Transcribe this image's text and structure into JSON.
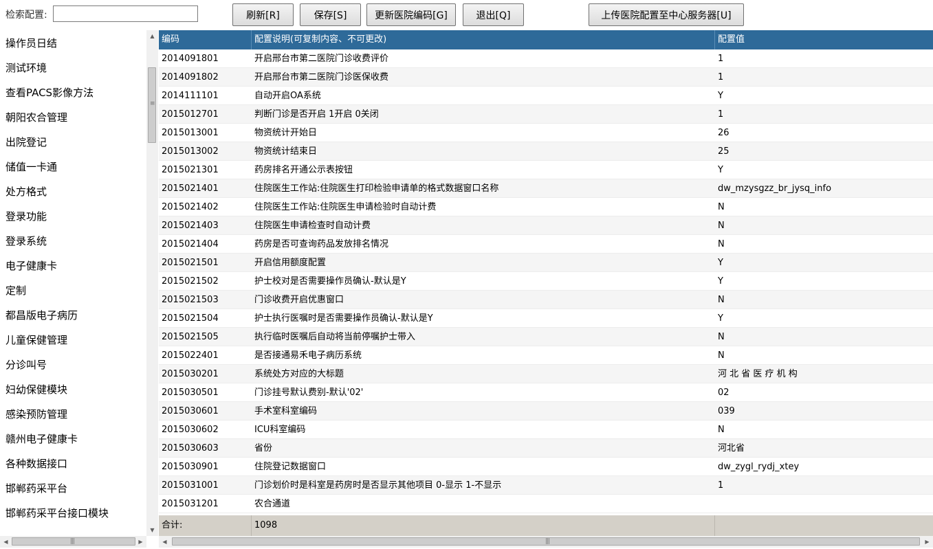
{
  "toolbar": {
    "search_label": "检索配置:",
    "search_value": "",
    "buttons": {
      "refresh": "刷新[R]",
      "save": "保存[S]",
      "update_code": "更新医院编码[G]",
      "exit": "退出[Q]",
      "upload": "上传医院配置至中心服务器[U]"
    }
  },
  "categories": [
    "操作员日结",
    "测试环境",
    "查看PACS影像方法",
    "朝阳农合管理",
    "出院登记",
    "储值一卡通",
    "处方格式",
    "登录功能",
    "登录系统",
    "电子健康卡",
    "定制",
    "都昌版电子病历",
    "儿童保健管理",
    "分诊叫号",
    "妇幼保健模块",
    "感染预防管理",
    "赣州电子健康卡",
    "各种数据接口",
    "邯郸药采平台",
    "邯郸药采平台接口模块"
  ],
  "grid": {
    "columns": [
      "编码",
      "配置说明(可复制内容、不可更改)",
      "配置值"
    ],
    "rows": [
      [
        "2014091801",
        "开启邢台市第二医院门诊收费评价",
        "1"
      ],
      [
        "2014091802",
        "开启邢台市第二医院门诊医保收费",
        "1"
      ],
      [
        "2014111101",
        "自动开启OA系统",
        "Y"
      ],
      [
        "2015012701",
        "判断门诊是否开启 1开启 0关闭",
        "1"
      ],
      [
        "2015013001",
        "物资统计开始日",
        "26"
      ],
      [
        "2015013002",
        "物资统计结束日",
        "25"
      ],
      [
        "2015021301",
        "药房排名开通公示表按钮",
        "Y"
      ],
      [
        "2015021401",
        "住院医生工作站:住院医生打印检验申请单的格式数据窗口名称",
        "dw_mzysgzz_br_jysq_info"
      ],
      [
        "2015021402",
        "住院医生工作站:住院医生申请检验时自动计费",
        "N"
      ],
      [
        "2015021403",
        "住院医生申请检查时自动计费",
        "N"
      ],
      [
        "2015021404",
        "药房是否可查询药品发放排名情况",
        "N"
      ],
      [
        "2015021501",
        "开启信用额度配置",
        "Y"
      ],
      [
        "2015021502",
        "护士校对是否需要操作员确认-默认是Y",
        "Y"
      ],
      [
        "2015021503",
        "门诊收费开启优惠窗口",
        "N"
      ],
      [
        "2015021504",
        "护士执行医嘱时是否需要操作员确认-默认是Y",
        "Y"
      ],
      [
        "2015021505",
        "执行临时医嘱后自动将当前停嘱护士带入",
        "N"
      ],
      [
        "2015022401",
        "是否接通易禾电子病历系统",
        "N"
      ],
      [
        "2015030201",
        "系统处方对应的大标题",
        "河 北 省 医 疗 机 构"
      ],
      [
        "2015030501",
        "门诊挂号默认费别-默认'02'",
        "02"
      ],
      [
        "2015030601",
        "手术室科室编码",
        "039"
      ],
      [
        "2015030602",
        "ICU科室编码",
        "N"
      ],
      [
        "2015030603",
        "省份",
        "河北省"
      ],
      [
        "2015030901",
        "住院登记数据窗口",
        "dw_zygl_rydj_xtey"
      ],
      [
        "2015031001",
        "门诊划价时是科室是药房时是否显示其他项目 0-显示 1-不显示",
        "1"
      ],
      [
        "2015031201",
        "农合通道",
        ""
      ]
    ],
    "footer": {
      "label": "合计:",
      "count": "1098"
    }
  },
  "icons": {
    "scroll_up": "triangle-up-icon",
    "scroll_down": "triangle-down-icon",
    "scroll_left": "triangle-left-icon",
    "scroll_right": "triangle-right-icon",
    "grip": "grip-lines-icon"
  }
}
